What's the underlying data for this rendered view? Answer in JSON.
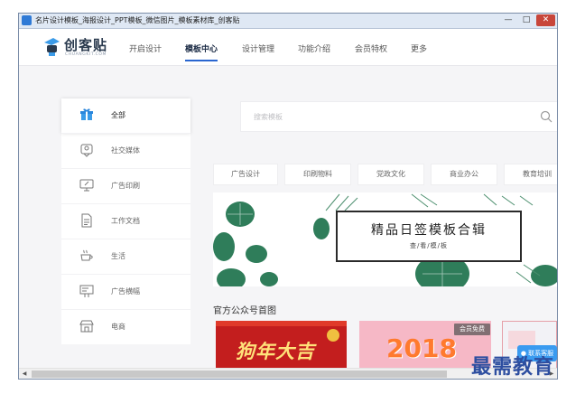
{
  "window": {
    "title": "名片设计模板_海报设计_PPT模板_微信图片_模板素材库_创客贴",
    "controls": {
      "minimize": "—",
      "maximize": "□",
      "close": "✕"
    }
  },
  "logo": {
    "text": "创客贴",
    "subtext": "CHUANGKIT.COM"
  },
  "nav": {
    "items": [
      {
        "label": "开启设计"
      },
      {
        "label": "模板中心"
      },
      {
        "label": "设计管理"
      },
      {
        "label": "功能介绍"
      },
      {
        "label": "会员特权"
      },
      {
        "label": "更多"
      }
    ],
    "active_index": 1
  },
  "sidebar": {
    "items": [
      {
        "label": "全部",
        "icon": "gift-box-icon"
      },
      {
        "label": "社交媒体",
        "icon": "social-icon"
      },
      {
        "label": "广告印刷",
        "icon": "monitor-icon"
      },
      {
        "label": "工作文档",
        "icon": "document-icon"
      },
      {
        "label": "生活",
        "icon": "coffee-icon"
      },
      {
        "label": "广告横幅",
        "icon": "banner-icon"
      },
      {
        "label": "电商",
        "icon": "shop-icon"
      }
    ],
    "active_index": 0
  },
  "search": {
    "placeholder": "搜索模板"
  },
  "categories": [
    {
      "label": "广告设计"
    },
    {
      "label": "印刷物料"
    },
    {
      "label": "党政文化"
    },
    {
      "label": "商业办公"
    },
    {
      "label": "教育培训"
    }
  ],
  "banner": {
    "title": "精品日签模板合辑",
    "subtitle": "查/看/模/板"
  },
  "section": {
    "title": "官方公众号首图"
  },
  "thumbnails": [
    {
      "text": "狗年大吉"
    },
    {
      "text": "2018",
      "badge": "会员免费"
    },
    {
      "text": ""
    }
  ],
  "help": {
    "label": "联系客服"
  },
  "watermark": {
    "text": "最需教育"
  },
  "colors": {
    "accent": "#2a66d0",
    "close": "#c8463a",
    "help": "#3a9bf0",
    "watermark": "#2d4ea0"
  }
}
